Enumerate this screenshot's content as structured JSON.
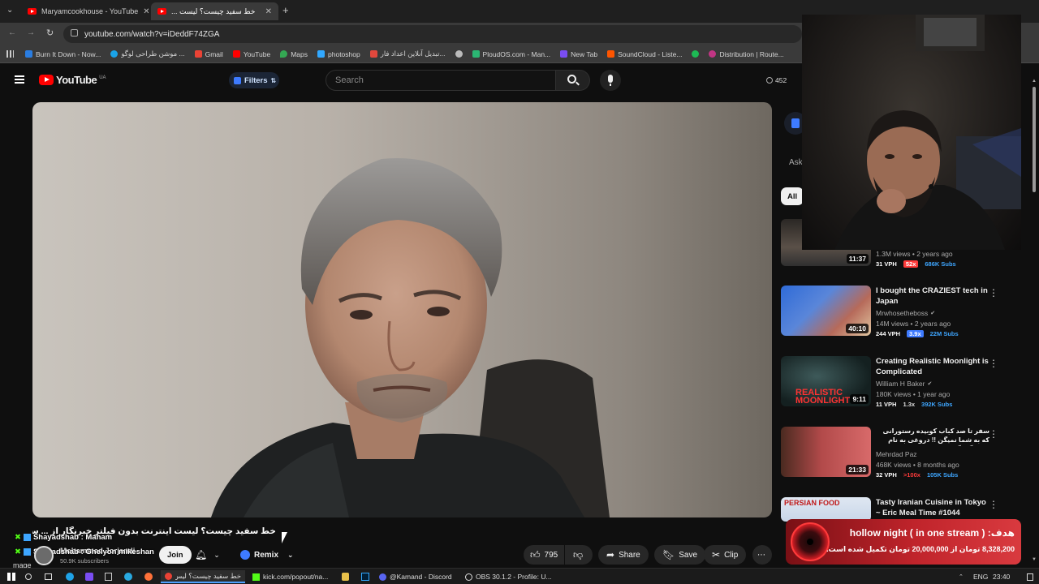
{
  "browser": {
    "tabs": [
      {
        "label": "Maryamcookhouse - YouTube",
        "active": false
      },
      {
        "label": "خط سفید چیست؟ لیست ...",
        "active": true
      }
    ],
    "url": "youtube.com/watch?v=iDeddF74ZGA",
    "bookmarks": [
      {
        "label": "Burn It Down - Now...",
        "color": "#2a7de1"
      },
      {
        "label": "موشن طراحی لوگو ...",
        "color": "#1aa3e8"
      },
      {
        "label": "Gmail",
        "color": "#ea4335"
      },
      {
        "label": "YouTube",
        "color": "#ff0000"
      },
      {
        "label": "Maps",
        "color": "#34a853"
      },
      {
        "label": "photoshop",
        "color": "#31a8ff"
      },
      {
        "label": "تبدیل آنلاین اعداد فار...",
        "color": "#e2483d"
      },
      {
        "label": "",
        "color": "#bbbbbb"
      },
      {
        "label": "PloudOS.com - Man...",
        "color": "#2bb673"
      },
      {
        "label": "New Tab",
        "color": "#7a4df2"
      },
      {
        "label": "SoundCloud - Liste...",
        "color": "#ff5500"
      },
      {
        "label": "",
        "color": "#1db954"
      },
      {
        "label": "Distribution | Route...",
        "color": "#c13584"
      }
    ]
  },
  "youtube": {
    "logo": "YouTube",
    "country": "UA",
    "filters": "Filters",
    "search_placeholder": "Search",
    "counter": "452"
  },
  "video": {
    "title": "خط سفید چیست؟ لیست اینترنت بدون فیلتر خبرنگار از ... سیاسی و ...",
    "channel_overlay_1": "Shayadshab : Maham",
    "channel_overlay_2": "Shayadshab : Ghelyon mikeshan",
    "channel_name": "Mohammad Jorjandi",
    "subscribers": "50.9K subscribers",
    "partial_label": "mage",
    "join_label": "Join",
    "remix_label": "Remix",
    "likes": "795",
    "share_label": "Share",
    "save_label": "Save",
    "clip_label": "Clip"
  },
  "sidebar": {
    "partial_ask": "Ask",
    "chip_all": "All",
    "items": [
      {
        "title": "",
        "channel": "",
        "meta": "1.3M views • 2 years ago",
        "duration": "11:37",
        "vph": "31 VPH",
        "mult": "52x",
        "subs": "686K Subs",
        "mult_color": "#ff3b3b",
        "thumb": "#5a5048"
      },
      {
        "title": "I bought the CRAZIEST tech in Japan",
        "channel": "Mrwhosetheboss",
        "meta": "14M views • 2 years ago",
        "duration": "40:10",
        "vph": "244 VPH",
        "mult": "3.9x",
        "subs": "22M Subs",
        "mult_color": "#3ea6ff",
        "thumb": "#3b5bb3"
      },
      {
        "title": "Creating Realistic Moonlight is Complicated",
        "channel": "William H Baker",
        "meta": "180K views • 1 year ago",
        "duration": "9:11",
        "vph": "11 VPH",
        "mult": "1.3x",
        "subs": "392K Subs",
        "mult_color": "#bbbbbb",
        "thumb": "#1d2a2a"
      },
      {
        "title": "سفر تا صد کباب کوبیده رستورانی که به شما نمیگن !! دروغی به نام فلوه گاه گوسفندی",
        "channel": "Mehrdad Paz",
        "meta": "468K views • 8 months ago",
        "duration": "21:33",
        "vph": "32 VPH",
        "mult": ">100x",
        "subs": "105K Subs",
        "mult_color": "#ff3b3b",
        "thumb": "#a03a3a"
      },
      {
        "title": "Tasty Iranian Cuisine in Tokyo ~ Eric Meal Time #1044",
        "channel": "",
        "meta": "",
        "duration": "",
        "vph": "",
        "mult": "",
        "subs": "",
        "mult_color": "#bbbbbb",
        "thumb": "#c8d6e8"
      }
    ],
    "thumb_texts": [
      "REALISTIC MOONLIGHT",
      "PERSIAN FOOD"
    ]
  },
  "donation": {
    "title": "هدف: ( in one stream ) hollow night",
    "progress_text": "8,328,200 تومان از 20,000,000 تومان تکمیل شده است."
  },
  "taskbar": {
    "items": [
      {
        "label": "خط سفید چیست؟ لیس..."
      },
      {
        "label": "kick.com/popout/na..."
      },
      {
        "label": "@Kamand - Discord"
      },
      {
        "label": "OBS 30.1.2 - Profile: U..."
      }
    ],
    "lang": "ENG",
    "time": "23:40"
  }
}
